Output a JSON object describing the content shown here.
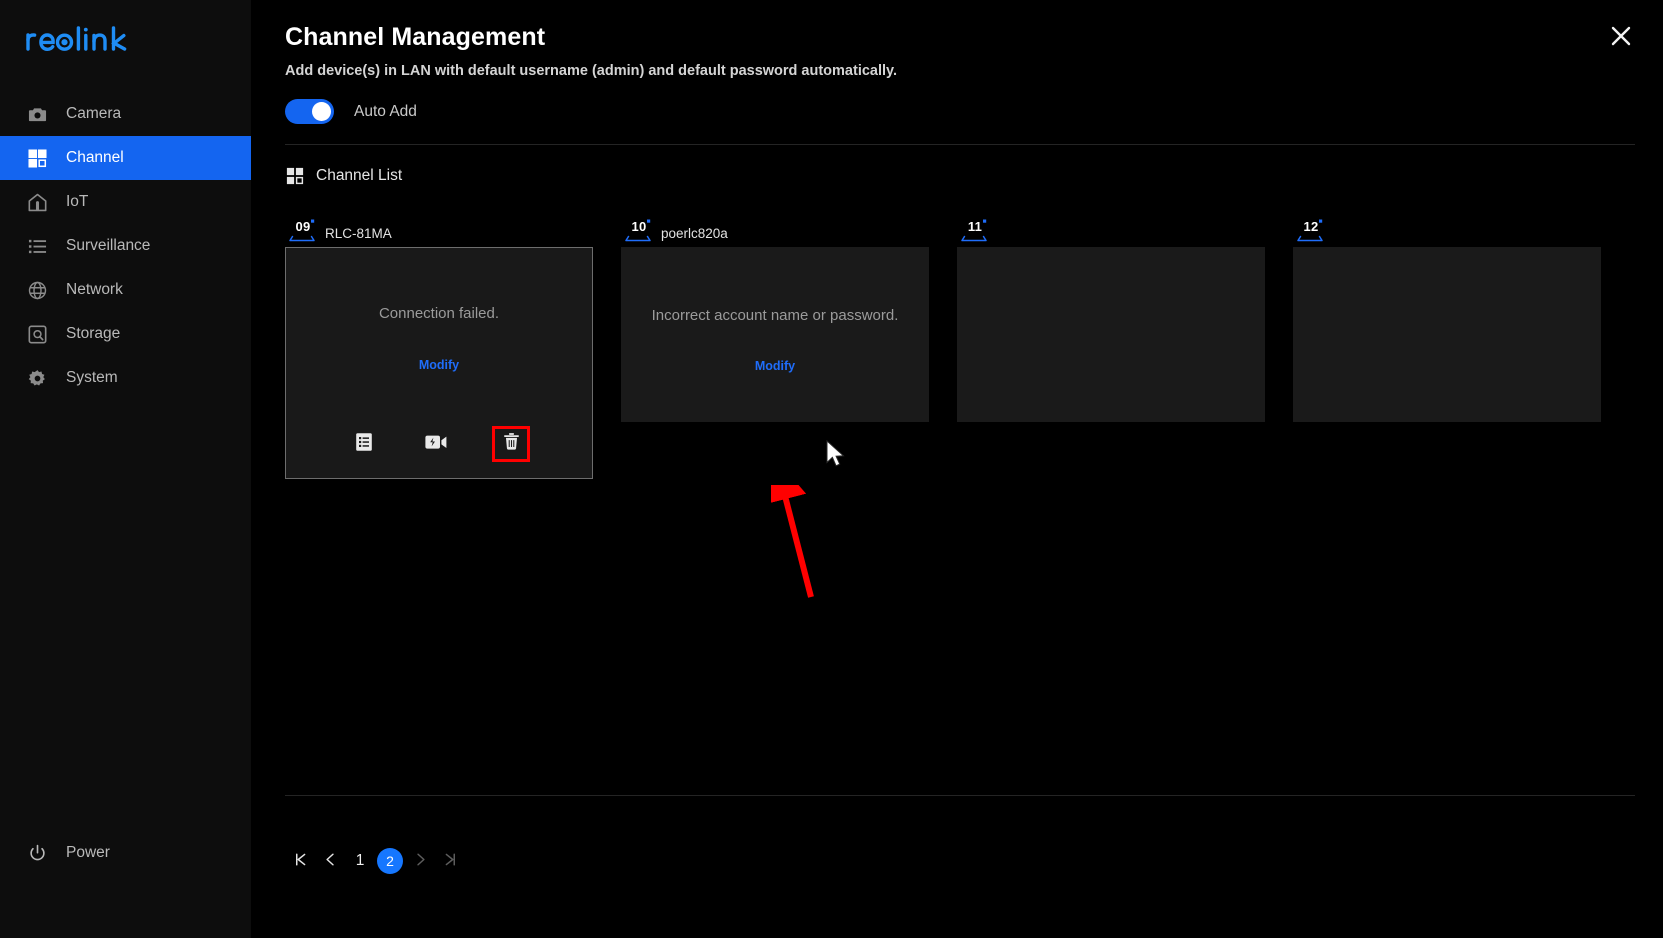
{
  "brand": {
    "name": "reolink"
  },
  "sidebar": {
    "items": [
      {
        "label": "Camera",
        "icon": "camera-icon",
        "active": false
      },
      {
        "label": "Channel",
        "icon": "grid-icon",
        "active": true
      },
      {
        "label": "IoT",
        "icon": "home-icon",
        "active": false
      },
      {
        "label": "Surveillance",
        "icon": "list-icon",
        "active": false
      },
      {
        "label": "Network",
        "icon": "globe-icon",
        "active": false
      },
      {
        "label": "Storage",
        "icon": "hard-drive-icon",
        "active": false
      },
      {
        "label": "System",
        "icon": "gear-icon",
        "active": false
      }
    ],
    "power": {
      "label": "Power",
      "icon": "power-icon"
    }
  },
  "header": {
    "title": "Channel Management",
    "subtitle": "Add device(s) in LAN with default username (admin) and default password automatically.",
    "close_icon": "close-icon"
  },
  "auto_add": {
    "label": "Auto Add",
    "enabled": true
  },
  "channel_list": {
    "section_label": "Channel List",
    "section_icon": "grid-icon",
    "cards": [
      {
        "number": "09",
        "name": "RLC-81MA",
        "message": "Connection failed.",
        "modify_label": "Modify",
        "has_actions": true,
        "selected": true,
        "actions": [
          {
            "icon": "device-info-icon",
            "highlighted": false
          },
          {
            "icon": "camera-flash-icon",
            "highlighted": false
          },
          {
            "icon": "trash-icon",
            "highlighted": true
          }
        ]
      },
      {
        "number": "10",
        "name": "poerlc820a",
        "message": "Incorrect account name or password.",
        "modify_label": "Modify",
        "has_actions": false,
        "selected": false,
        "actions": []
      },
      {
        "number": "11",
        "name": "",
        "message": "",
        "modify_label": "",
        "has_actions": false,
        "selected": false,
        "actions": []
      },
      {
        "number": "12",
        "name": "",
        "message": "",
        "modify_label": "",
        "has_actions": false,
        "selected": false,
        "actions": []
      }
    ]
  },
  "pagination": {
    "first_icon": "first-page-icon",
    "prev_icon": "prev-page-icon",
    "pages": [
      "1",
      "2"
    ],
    "active_page": "2",
    "next_icon": "next-page-icon",
    "last_icon": "last-page-icon"
  },
  "colors": {
    "accent": "#1465f0",
    "link": "#1f6dfa",
    "annotation": "#ff0000",
    "background": "#000000",
    "sidebar_bg": "#0d0d0d",
    "card_bg": "#1a1a1a"
  }
}
